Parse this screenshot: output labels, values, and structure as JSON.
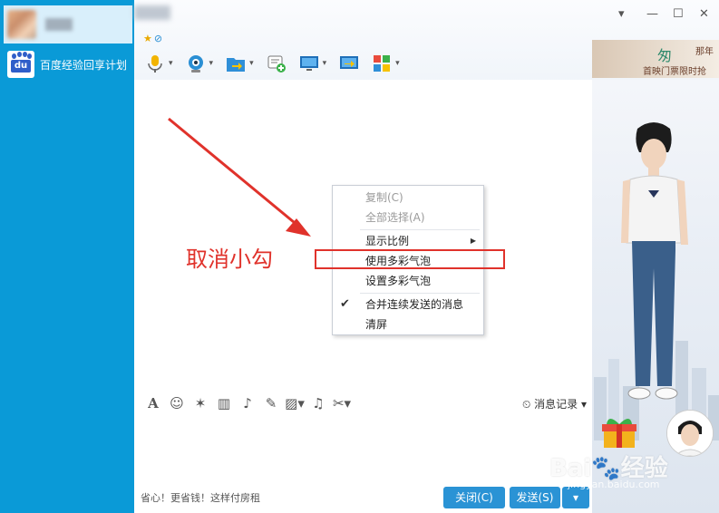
{
  "sidebar": {
    "contacts": [
      {
        "name": "",
        "avatar": "blurred"
      },
      {
        "name": "百度经验回享计划",
        "avatar": "baidu-du-logo"
      }
    ],
    "baidu_logo_text": "du"
  },
  "toolbar": {
    "icons": [
      "microphone-icon",
      "webcam-icon",
      "file-transfer-icon",
      "add-chat-icon",
      "remote-desktop-icon",
      "share-screen-icon",
      "apps-icon"
    ]
  },
  "ad": {
    "line1": "匆",
    "line2": "那年",
    "line3": "首映门票限时抢"
  },
  "context_menu": {
    "items": [
      {
        "label": "复制(C)",
        "disabled": true
      },
      {
        "label": "全部选择(A)",
        "disabled": true
      },
      {
        "label": "显示比例",
        "has_submenu": true
      },
      {
        "label": "使用多彩气泡",
        "highlighted": true
      },
      {
        "label": "设置多彩气泡"
      },
      {
        "label": "合并连续发送的消息",
        "checked": true
      },
      {
        "label": "清屏"
      }
    ]
  },
  "annotation": {
    "text": "取消小勾",
    "color": "#e0322b"
  },
  "input_toolbar": {
    "icons": [
      "font-icon",
      "emoji-icon",
      "magic-icon",
      "video-icon",
      "voice-icon",
      "edit-icon",
      "image-icon",
      "music-icon",
      "screenshot-icon"
    ],
    "message_record_label": "消息记录"
  },
  "footer": {
    "status_text": "省心！更省钱！这样付房租",
    "close_label": "关闭(C)",
    "send_label": "发送(S)"
  },
  "watermark": {
    "text": "Bai🐾经验",
    "sub": "jingyan.baidu.com"
  },
  "colors": {
    "sidebar": "#0a9ad7",
    "accent": "#2a93d5",
    "annotation": "#e0322b"
  }
}
